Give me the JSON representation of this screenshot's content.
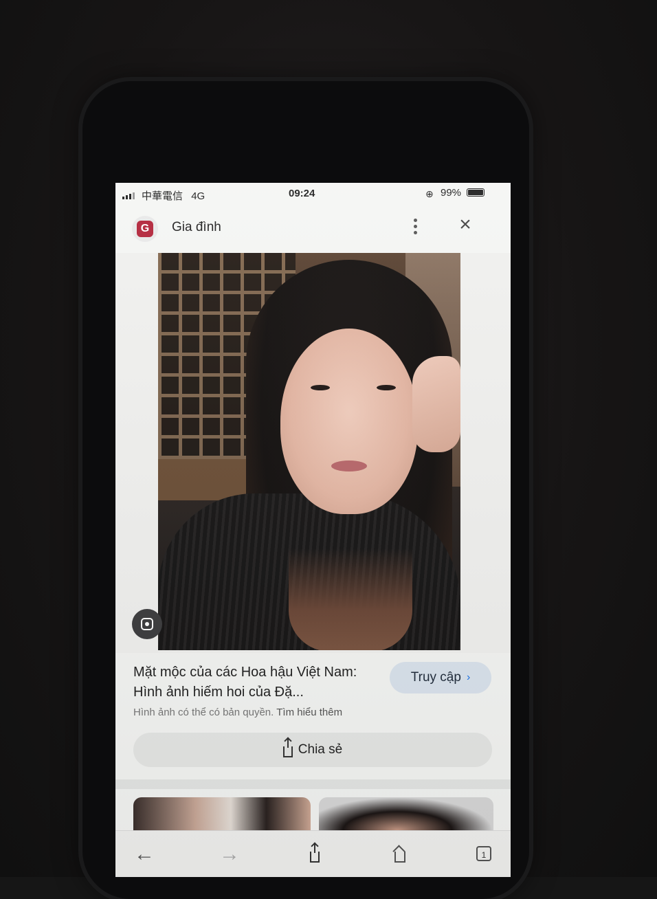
{
  "status_bar": {
    "carrier": "中華電信",
    "network": "4G",
    "time": "09:24",
    "battery": "99%",
    "battery_level": 0.99,
    "icons": [
      "signal-icon",
      "orientation-lock-icon",
      "battery-icon"
    ]
  },
  "header": {
    "site_logo_letter": "G",
    "site_name": "Gia đình",
    "icons": [
      "more-vertical-icon",
      "close-icon"
    ]
  },
  "image": {
    "description_icon": "lens-icon"
  },
  "caption": {
    "title": "Mặt mộc của các Hoa hậu Việt Nam: Hình ảnh hiếm hoi của Đặ...",
    "visit_label": "Truy cập",
    "copyright_notice": "Hình ảnh có thể có bản quyền.",
    "learn_more": "Tìm hiểu thêm",
    "share_label": "Chia sẻ"
  },
  "toolbar": {
    "back_glyph": "←",
    "forward_glyph": "→",
    "tab_count": "1"
  },
  "colors": {
    "accent_blue": "#1a73e8",
    "visit_button_bg": "#dbe4ee",
    "logo_red": "#b3263b"
  }
}
